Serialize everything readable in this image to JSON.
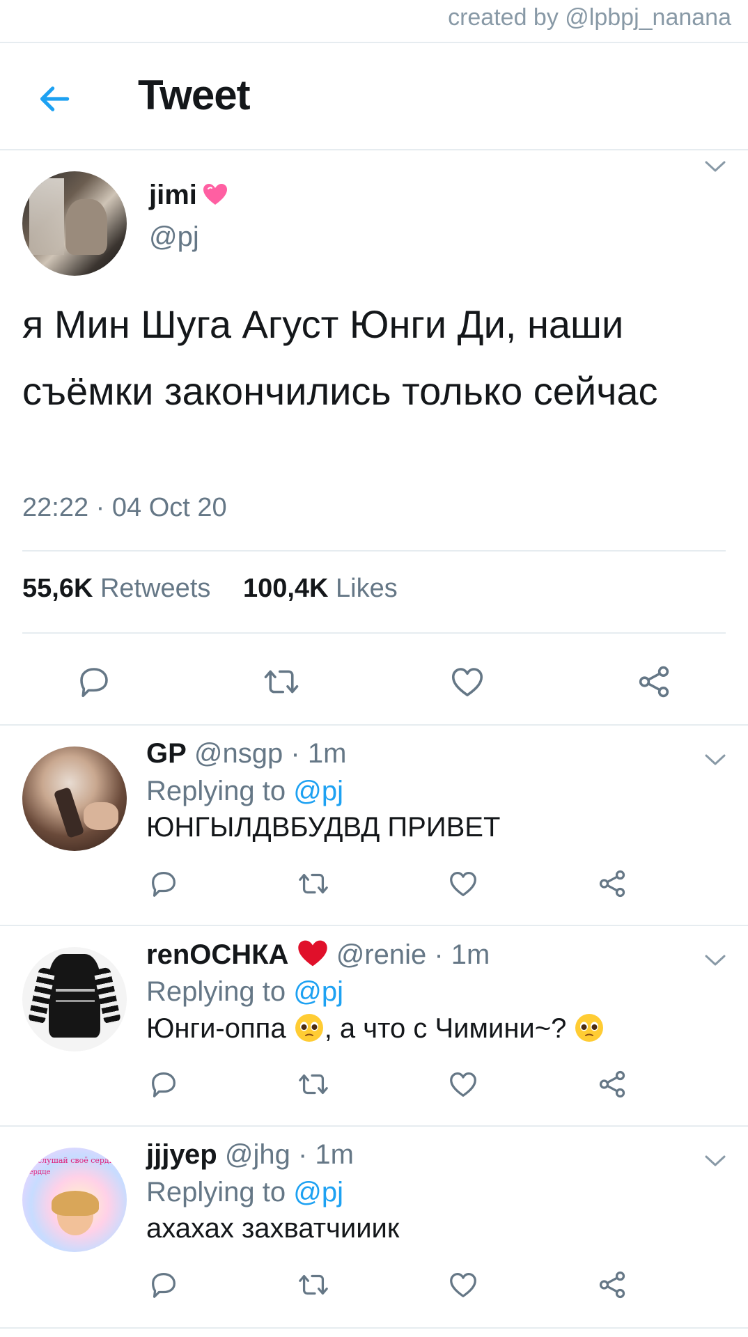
{
  "credit": "created by @lpbpj_nanana",
  "header": {
    "title": "Tweet"
  },
  "tweet": {
    "name": "jimi",
    "handle": "@pj",
    "text": "я Мин Шуга Агуст Юнги Ди, наши съёмки закончились только сейчас",
    "time": "22:22 · 04 Oct 20",
    "retweets_count": "55,6K",
    "retweets_label": "Retweets",
    "likes_count": "100,4K",
    "likes_label": "Likes"
  },
  "replying_label": "Replying to",
  "replying_handle": "@pj",
  "replies": [
    {
      "name": "GP",
      "handle": "@nsgp",
      "time": "· 1m",
      "text": "ЮНГЫЛДВБУДВД ПРИВЕТ"
    },
    {
      "name": "renОСНКА",
      "handle": "@renie",
      "time": "· 1m",
      "text_a": "Юнги-оппа",
      "text_b": ",  а что с Чимини~?"
    },
    {
      "name": "jjjуер",
      "handle": "@jhg",
      "time": "· 1m",
      "text": "ахахах захватчииик"
    }
  ],
  "avatar3_text": {
    "line1": "слушай своё сердце",
    "line2": "сердце"
  },
  "colors": {
    "accent": "#1da1f2",
    "muted": "#657786",
    "divider": "#e6ecf0"
  },
  "icons": [
    "back-arrow-icon",
    "heart-emoji-icon",
    "chevron-down-icon",
    "reply-icon",
    "retweet-icon",
    "like-icon",
    "share-icon",
    "pleading-face-emoji",
    "red-heart-emoji"
  ]
}
